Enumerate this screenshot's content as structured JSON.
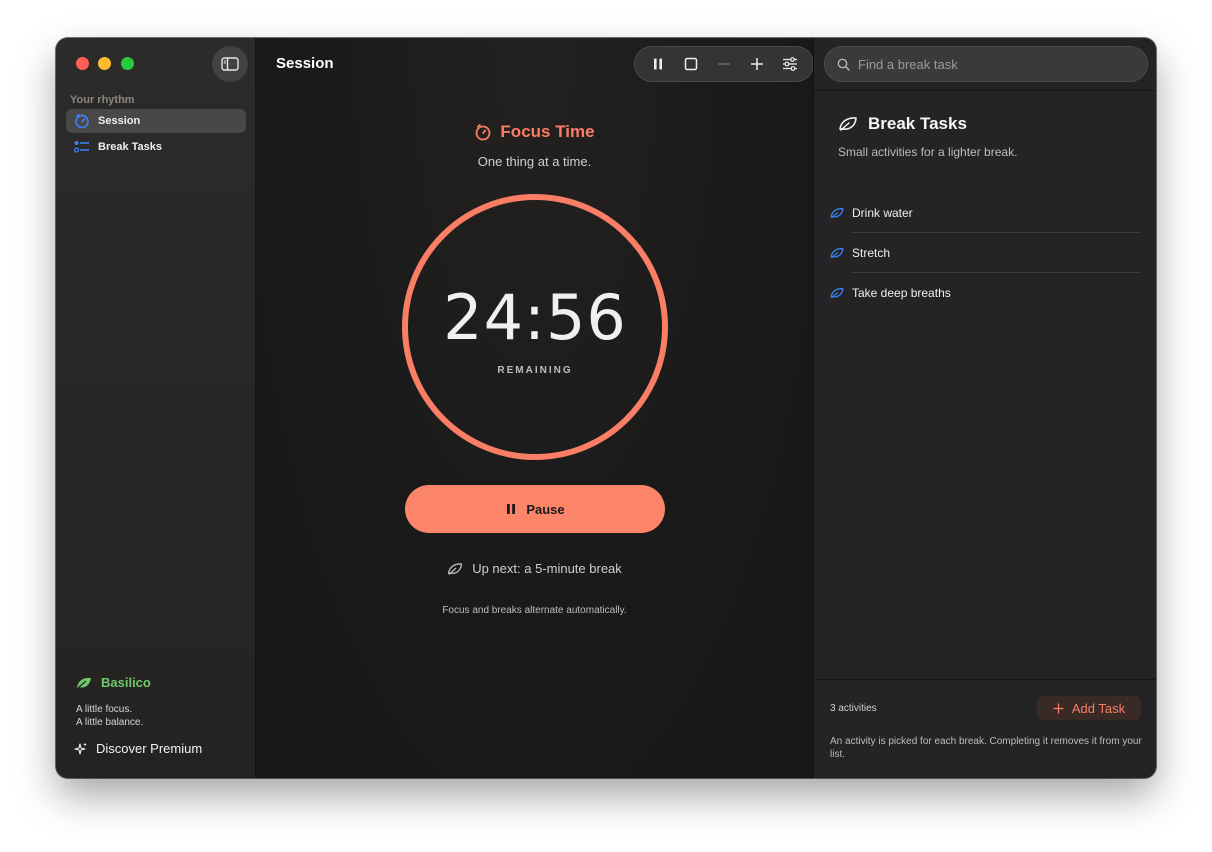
{
  "sidebar": {
    "section_label": "Your rhythm",
    "items": [
      {
        "label": "Session",
        "icon": "timer-icon",
        "active": true
      },
      {
        "label": "Break Tasks",
        "icon": "list-icon",
        "active": false
      }
    ],
    "brand": {
      "name": "Basilico",
      "icon": "leaf-icon",
      "color": "#6fc86a"
    },
    "tagline_line1": "A little focus.",
    "tagline_line2": "A little balance.",
    "premium_label": "Discover Premium"
  },
  "center": {
    "title": "Session",
    "focus_title": "Focus Time",
    "focus_subtitle": "One thing at a time.",
    "timer": "24:56",
    "remaining_label": "REMAINING",
    "pause_label": "Pause",
    "up_next": "Up next: a 5-minute break",
    "auto_note": "Focus and breaks alternate automatically.",
    "accent_color": "#fa7d66"
  },
  "toolbar": {
    "buttons": [
      "pause-icon",
      "stop-icon",
      "minus-icon",
      "plus-icon",
      "sliders-icon"
    ]
  },
  "right": {
    "search_placeholder": "Find a break task",
    "title": "Break Tasks",
    "subtitle": "Small activities for a lighter break.",
    "tasks": [
      {
        "label": "Drink water"
      },
      {
        "label": "Stretch"
      },
      {
        "label": "Take deep breaths"
      }
    ],
    "count_label": "3 activities",
    "add_task_label": "Add Task",
    "footer_note": "An activity is picked for each break. Completing it removes it from your list."
  }
}
